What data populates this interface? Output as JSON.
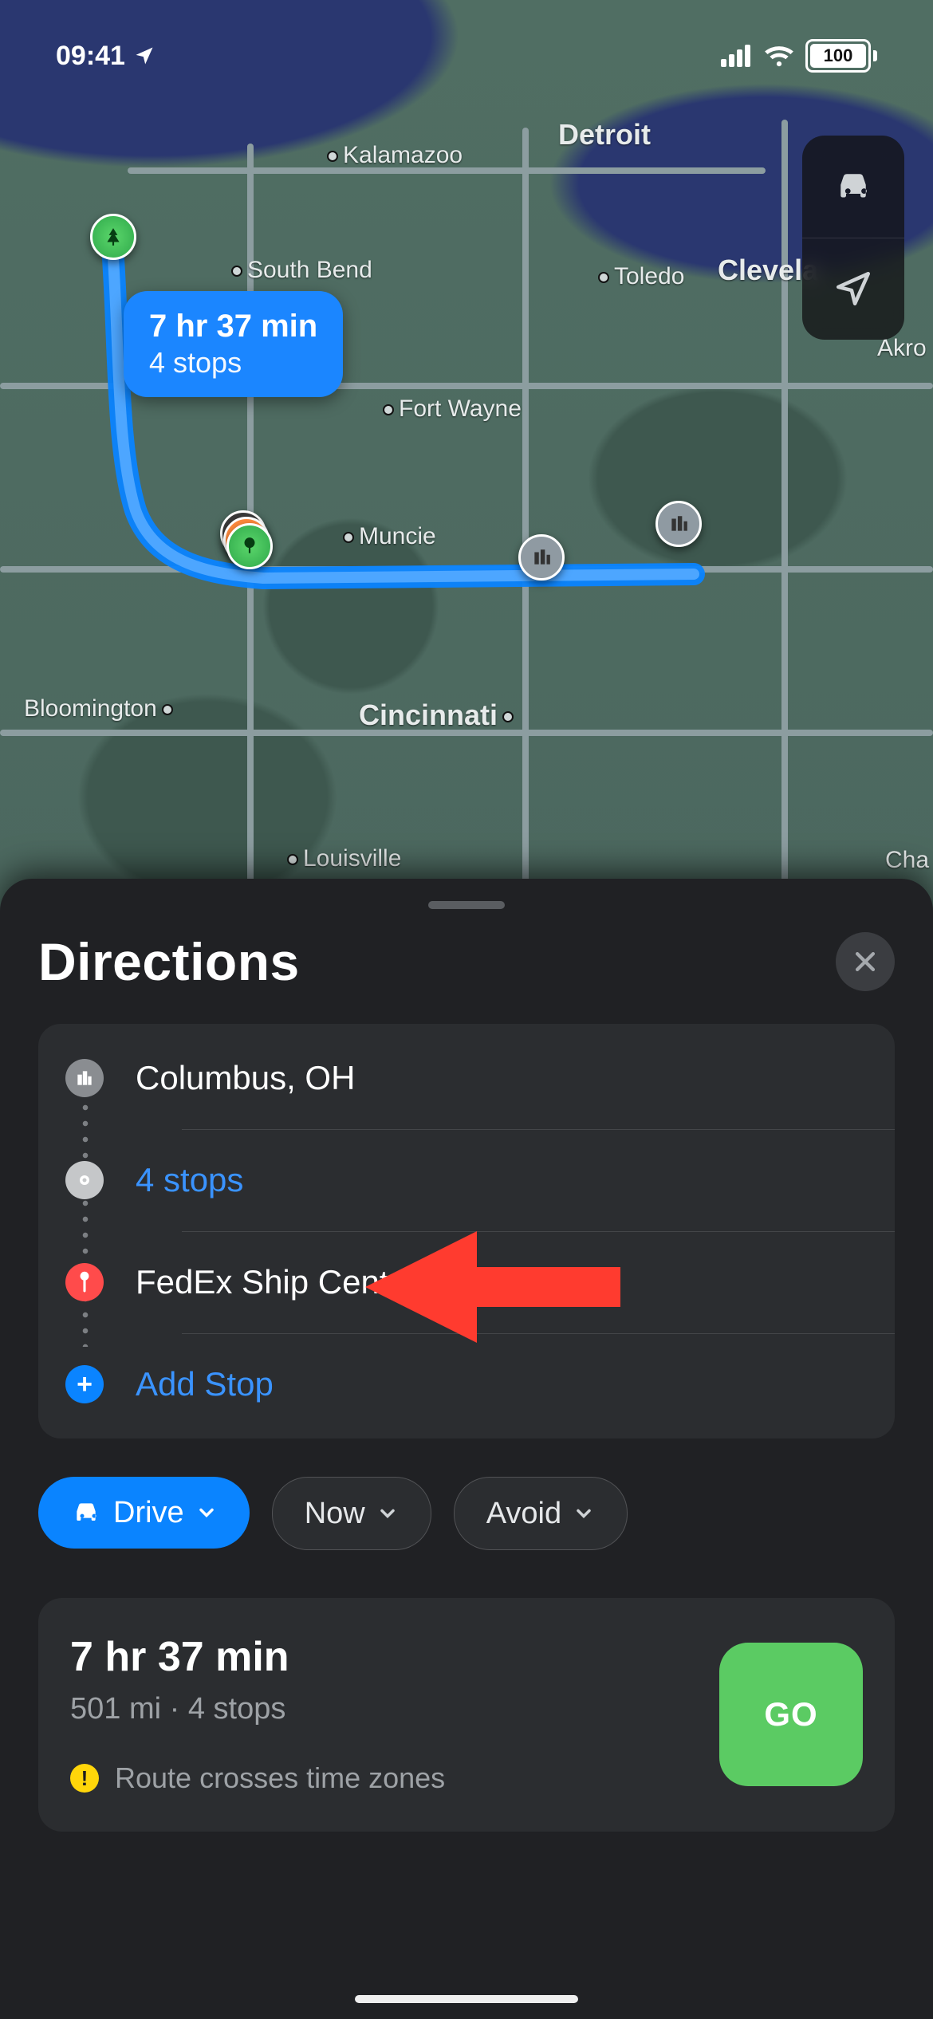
{
  "status": {
    "time": "09:41",
    "battery": "100"
  },
  "map": {
    "cities": {
      "detroit": "Detroit",
      "kalamazoo": "Kalamazoo",
      "south_bend": "South Bend",
      "toledo": "Toledo",
      "cleveland": "Clevela",
      "akron": "Akro",
      "fort_wayne": "Fort Wayne",
      "muncie": "Muncie",
      "bloomington": "Bloomington",
      "cincinnati": "Cincinnati",
      "louisville": "Louisville",
      "cha": "Cha"
    },
    "callout": {
      "time": "7 hr 37 min",
      "stops": "4 stops"
    }
  },
  "sheet": {
    "title": "Directions",
    "stops": {
      "origin": "Columbus, OH",
      "mid": "4 stops",
      "dest": "FedEx Ship Center",
      "add": "Add Stop"
    },
    "pills": {
      "drive": "Drive",
      "now": "Now",
      "avoid": "Avoid"
    },
    "route_card": {
      "time": "7 hr 37 min",
      "sub": "501 mi · 4 stops",
      "warning": "Route crosses time zones",
      "go": "GO"
    }
  }
}
